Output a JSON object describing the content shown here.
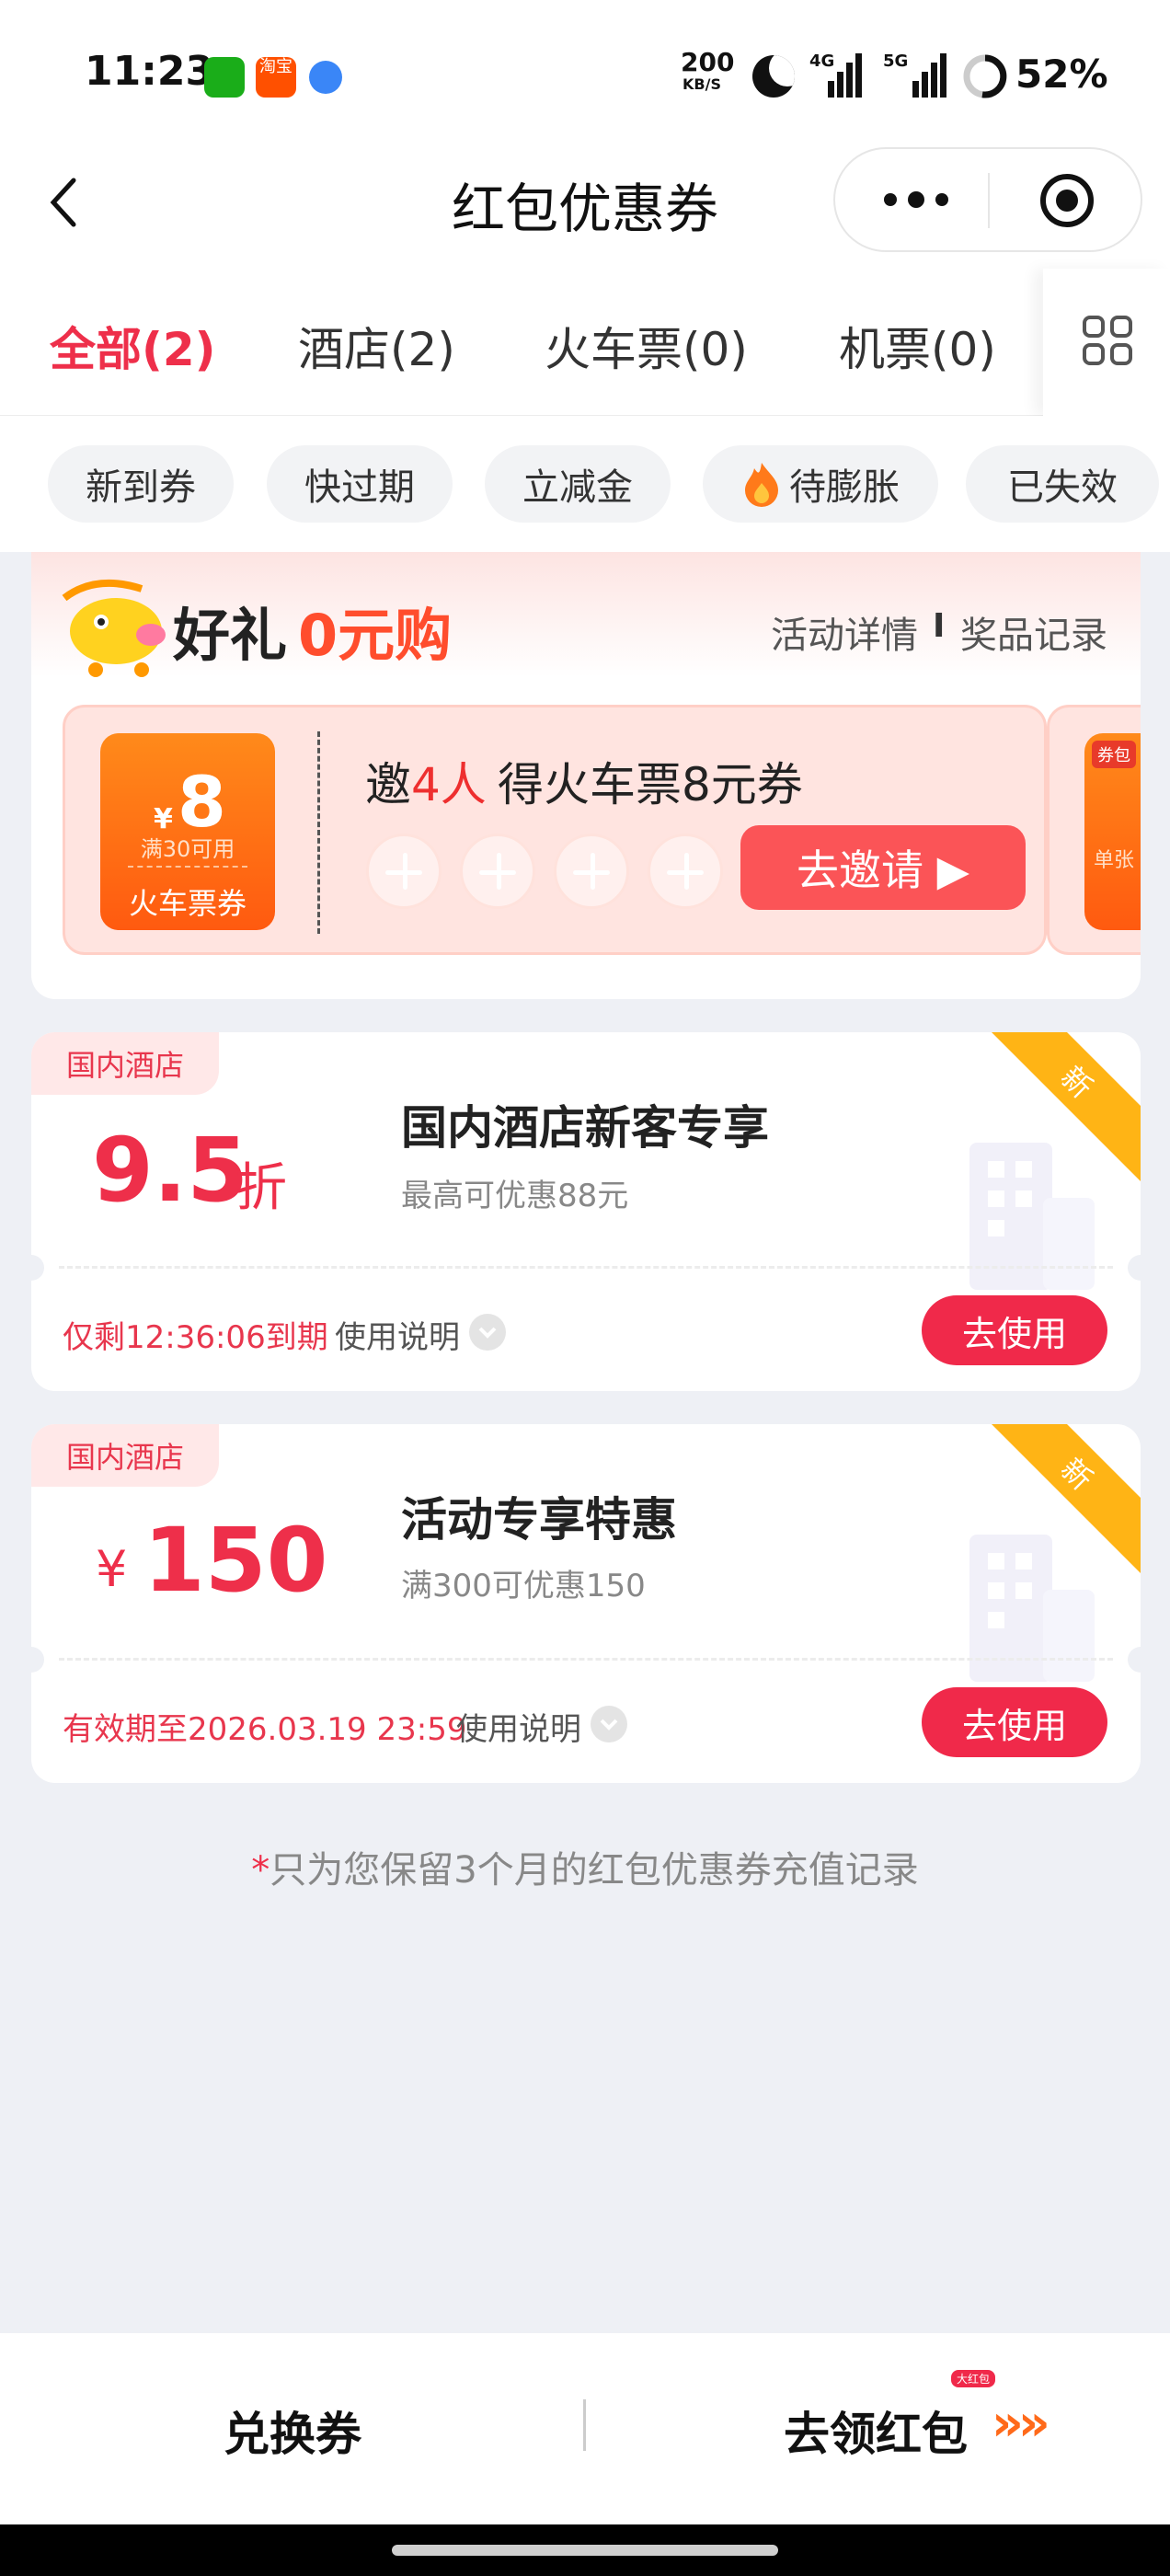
{
  "status_bar": {
    "time": "11:23",
    "speed_value": "200",
    "speed_unit": "KB/S",
    "net1": "4G",
    "net2": "5G",
    "battery": "52%",
    "notification_icons": [
      "wechat-icon",
      "taobao-icon",
      "browser-icon"
    ],
    "taobao_text": "淘宝"
  },
  "nav": {
    "title": "红包优惠券"
  },
  "tabs": [
    {
      "label": "全部(2)",
      "active": true
    },
    {
      "label": "酒店(2)",
      "active": false
    },
    {
      "label": "火车票(0)",
      "active": false
    },
    {
      "label": "机票(0)",
      "active": false
    }
  ],
  "filter_chips": [
    "新到券",
    "快过期",
    "立减金",
    "待膨胀",
    "已失效"
  ],
  "promo": {
    "title_a": "好礼",
    "title_b": "0元购",
    "detail_link": "活动详情",
    "divider": "I",
    "record_link": "奖品记录",
    "coupon_currency": "¥",
    "coupon_value": "8",
    "coupon_condition": "满30可用",
    "coupon_type": "火车票券",
    "invite_a": "邀",
    "invite_b": "4人",
    "invite_c": "得火车票8元券",
    "invite_button": "去邀请 ▶",
    "side_tag": "券包",
    "side_text": "单张"
  },
  "coupons": [
    {
      "tag": "国内酒店",
      "value": "9.5",
      "unit": "折",
      "title": "国内酒店新客专享",
      "desc": "最高可优惠88元",
      "badge": "新",
      "expiry": "仅剩12:36:06到期",
      "instructions": "使用说明",
      "button": "去使用"
    },
    {
      "tag": "国内酒店",
      "currency": "¥",
      "value": "150",
      "title": "活动专享特惠",
      "desc": "满300可优惠150",
      "badge": "新",
      "expiry": "有效期至2026.03.19 23:59",
      "instructions": "使用说明",
      "button": "去使用"
    }
  ],
  "footnote_star": "*",
  "footnote": "只为您保留3个月的红包优惠券充值记录",
  "bottom": {
    "exchange": "兑换券",
    "get_redpacket": "去领红包",
    "mini_tag": "大红包",
    "arrows": "»»"
  },
  "colors": {
    "accent": "#ee2f4a",
    "orange": "#ff6a1a",
    "badge_yellow": "#ffb415",
    "page_bg": "#eef0f5"
  }
}
